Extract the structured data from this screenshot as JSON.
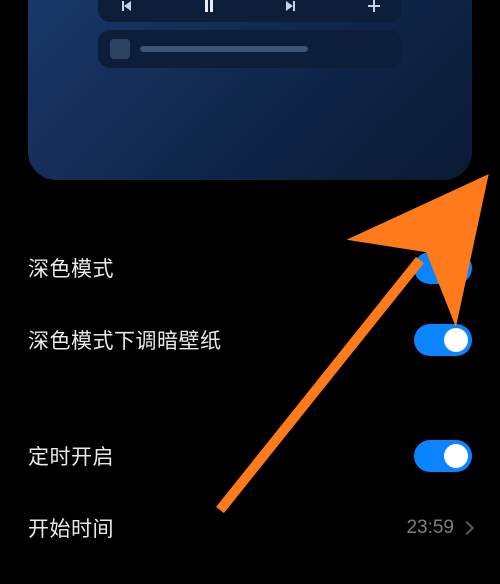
{
  "preview": {
    "icons": {
      "prev": "skip-previous-icon",
      "play": "pause-icon",
      "next": "skip-next-icon",
      "add": "plus-icon"
    }
  },
  "settings": {
    "dark_mode": {
      "label": "深色模式",
      "on": true
    },
    "dim_wallpaper": {
      "label": "深色模式下调暗壁纸",
      "on": true
    },
    "schedule": {
      "label": "定时开启",
      "on": true
    },
    "start_time": {
      "label": "开始时间",
      "value": "23:59"
    }
  },
  "colors": {
    "accent": "#0a84ff",
    "arrow": "#ff7a1a"
  }
}
